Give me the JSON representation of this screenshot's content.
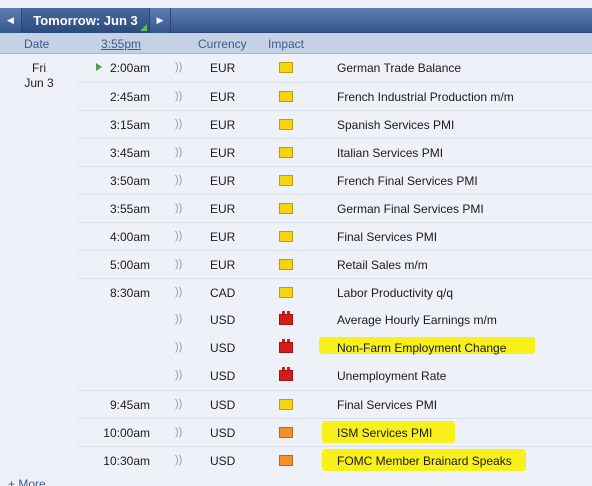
{
  "nav": {
    "prev_icon": "◀",
    "next_icon": "▶",
    "day_label": "Tomorrow: Jun 3"
  },
  "header": {
    "date": "Date",
    "time": "3:55pm",
    "currency": "Currency",
    "impact": "Impact"
  },
  "day": {
    "weekday": "Fri",
    "date": "Jun 3"
  },
  "sound_icon": "))",
  "events": [
    {
      "time": "2:00am",
      "currency": "EUR",
      "impact": "low",
      "title": "German Trade Balance",
      "next": true,
      "highlighted": false
    },
    {
      "time": "2:45am",
      "currency": "EUR",
      "impact": "low",
      "title": "French Industrial Production m/m",
      "highlighted": false
    },
    {
      "time": "3:15am",
      "currency": "EUR",
      "impact": "low",
      "title": "Spanish Services PMI",
      "highlighted": false
    },
    {
      "time": "3:45am",
      "currency": "EUR",
      "impact": "low",
      "title": "Italian Services PMI",
      "highlighted": false
    },
    {
      "time": "3:50am",
      "currency": "EUR",
      "impact": "low",
      "title": "French Final Services PMI",
      "highlighted": false
    },
    {
      "time": "3:55am",
      "currency": "EUR",
      "impact": "low",
      "title": "German Final Services PMI",
      "highlighted": false
    },
    {
      "time": "4:00am",
      "currency": "EUR",
      "impact": "low",
      "title": "Final Services PMI",
      "highlighted": false
    },
    {
      "time": "5:00am",
      "currency": "EUR",
      "impact": "low",
      "title": "Retail Sales m/m",
      "highlighted": false
    },
    {
      "time": "8:30am",
      "currency": "CAD",
      "impact": "low",
      "title": "Labor Productivity q/q",
      "highlighted": false
    },
    {
      "time": "",
      "currency": "USD",
      "impact": "high",
      "title": "Average Hourly Earnings m/m",
      "highlighted": false
    },
    {
      "time": "",
      "currency": "USD",
      "impact": "high",
      "title": "Non-Farm Employment Change",
      "highlighted": true
    },
    {
      "time": "",
      "currency": "USD",
      "impact": "high",
      "title": "Unemployment Rate",
      "highlighted": false
    },
    {
      "time": "9:45am",
      "currency": "USD",
      "impact": "low",
      "title": "Final Services PMI",
      "highlighted": false
    },
    {
      "time": "10:00am",
      "currency": "USD",
      "impact": "med",
      "title": "ISM Services PMI",
      "highlighted": true
    },
    {
      "time": "10:30am",
      "currency": "USD",
      "impact": "med",
      "title": "FOMC Member Brainard Speaks",
      "highlighted": true
    }
  ],
  "more_label": "More",
  "more_icon": "+",
  "colors": {
    "impact_low": "#f5d60c",
    "impact_med": "#f39029",
    "impact_high": "#d61b1b",
    "highlight": "#f7f01a",
    "nav_bar": "#34568c"
  }
}
